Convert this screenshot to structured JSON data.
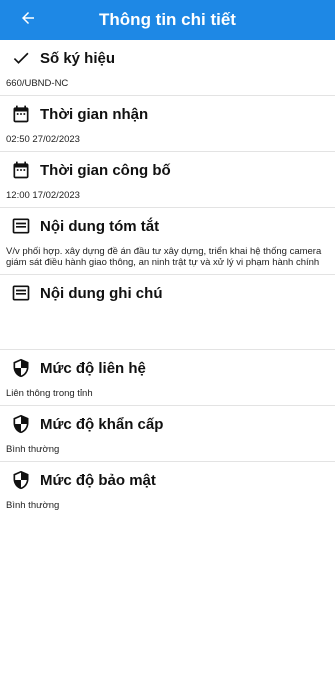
{
  "header": {
    "title": "Thông tin chi tiết",
    "back_icon": "arrow-left-icon",
    "color": "#1e88e5"
  },
  "sections": [
    {
      "label": "Số ký hiệu",
      "icon": "check-icon",
      "value": "660/UBND-NC"
    },
    {
      "label": "Thời gian nhận",
      "icon": "calendar-icon",
      "value": "02:50 27/02/2023"
    },
    {
      "label": "Thời gian công bố",
      "icon": "calendar-icon",
      "value": "12:00 17/02/2023"
    },
    {
      "label": "Nội dung tóm tắt",
      "icon": "notes-icon",
      "value": "V/v phối hợp. xây dựng đề án đầu tư xây dựng, triển khai hệ thống camera giám sát điều hành giao thông, an ninh trật tự và xử lý vi phạm hành chính"
    },
    {
      "label": "Nội dung ghi chú",
      "icon": "notes-icon",
      "value": ""
    },
    {
      "label": "Mức độ liên hệ",
      "icon": "shield-icon",
      "value": "Liên thông trong tỉnh"
    },
    {
      "label": "Mức độ khẩn cấp",
      "icon": "shield-icon",
      "value": "Bình thường"
    },
    {
      "label": "Mức độ bảo mật",
      "icon": "shield-icon",
      "value": "Bình thường"
    }
  ]
}
